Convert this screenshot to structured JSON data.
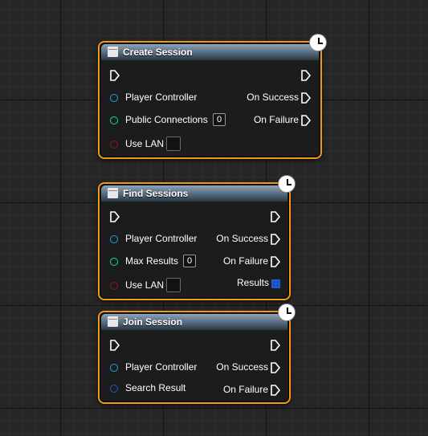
{
  "nodes": [
    {
      "title": "Create Session",
      "inputs": [
        {
          "label": "Player Controller",
          "pin": "object"
        },
        {
          "label": "Public Connections",
          "pin": "int",
          "value": "0"
        },
        {
          "label": "Use LAN",
          "pin": "bool",
          "checked": false
        }
      ],
      "outputs": [
        "On Success",
        "On Failure"
      ]
    },
    {
      "title": "Find Sessions",
      "inputs": [
        {
          "label": "Player Controller",
          "pin": "object"
        },
        {
          "label": "Max Results",
          "pin": "int",
          "value": "0"
        },
        {
          "label": "Use LAN",
          "pin": "bool",
          "checked": false
        }
      ],
      "outputs": [
        "On Success",
        "On Failure",
        "Results"
      ]
    },
    {
      "title": "Join Session",
      "inputs": [
        {
          "label": "Player Controller",
          "pin": "object"
        },
        {
          "label": "Search Result",
          "pin": "struct"
        }
      ],
      "outputs": [
        "On Success",
        "On Failure"
      ]
    }
  ],
  "colors": {
    "selection_outline": "#f19a14",
    "object_pin": "#1ea5ee",
    "int_pin": "#1fd7a1",
    "bool_pin": "#9c0f0f",
    "struct_pin": "#1c5bd1"
  },
  "icons": {
    "latent": "clock-icon",
    "function": "function-icon",
    "exec": "exec-pin-icon",
    "array": "array-grid-icon"
  }
}
